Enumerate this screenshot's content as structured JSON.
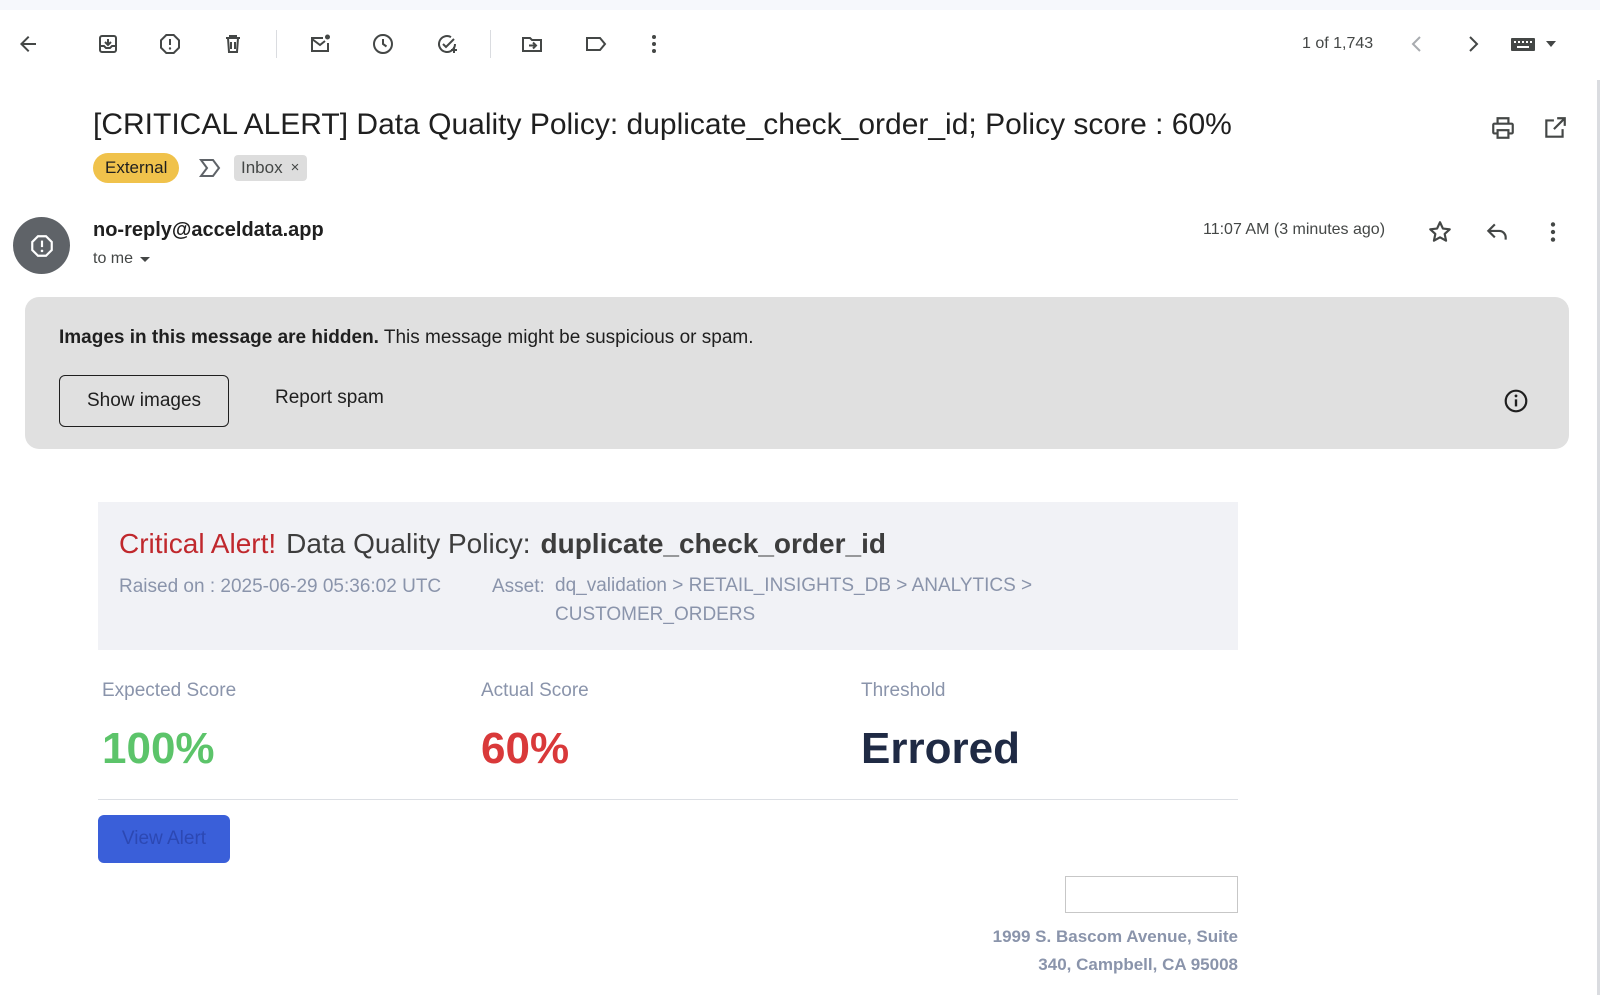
{
  "toolbar": {
    "icons": [
      "back-arrow-icon",
      "archive-icon",
      "report-spam-icon",
      "delete-icon",
      "mark-unread-icon",
      "snooze-icon",
      "add-task-icon",
      "move-to-icon",
      "label-icon",
      "more-vert-icon"
    ],
    "pager": "1 of 1,743"
  },
  "email": {
    "subject": "[CRITICAL ALERT] Data Quality Policy: duplicate_check_order_id; Policy score : 60%",
    "labels": {
      "external": "External",
      "inbox": "Inbox",
      "inbox_remove": "×"
    },
    "sender": "no-reply@acceldata.app",
    "to": "to me",
    "time": "11:07 AM (3 minutes ago)"
  },
  "banner": {
    "bold_text": "Images in this message are hidden.",
    "text": " This message might be suspicious or spam.",
    "show_images": "Show images",
    "report_spam": "Report spam"
  },
  "body": {
    "critical": "Critical Alert!",
    "policy_label": "Data Quality Policy:",
    "policy_name": "duplicate_check_order_id",
    "raised_on": "Raised on : 2025-06-29 05:36:02 UTC",
    "asset_label": "Asset:",
    "asset_path": "dq_validation > RETAIL_INSIGHTS_DB > ANALYTICS > CUSTOMER_ORDERS",
    "scores": [
      {
        "label": "Expected Score",
        "value": "100%",
        "color": "#5cc46a"
      },
      {
        "label": "Actual Score",
        "value": "60%",
        "color": "#d9393a"
      },
      {
        "label": "Threshold",
        "value": "Errored",
        "color": "#1f2a44"
      }
    ],
    "view_alert": "View Alert",
    "address_line1": "1999 S. Bascom Avenue, Suite",
    "address_line2": "340, Campbell, CA 95008"
  },
  "colors": {
    "external_label": "#f0c24b",
    "banner_bg": "#e0e0e0",
    "alert_bg": "#f1f2f6",
    "view_button": "#3a5fd9"
  }
}
